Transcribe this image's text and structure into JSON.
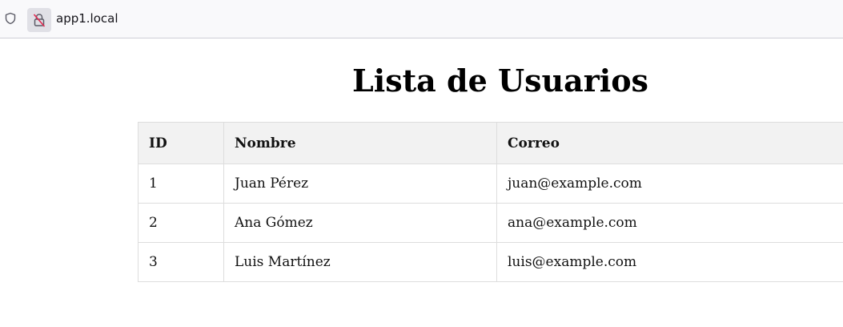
{
  "browser": {
    "host": "app1.local",
    "icons": [
      "shield-icon",
      "lock-insecure-icon"
    ]
  },
  "page": {
    "title": "Lista de Usuarios"
  },
  "table": {
    "headers": [
      "ID",
      "Nombre",
      "Correo"
    ],
    "rows": [
      [
        "1",
        "Juan Pérez",
        "juan@example.com"
      ],
      [
        "2",
        "Ana Gómez",
        "ana@example.com"
      ],
      [
        "3",
        "Luis Martínez",
        "luis@example.com"
      ]
    ]
  },
  "colors": {
    "header_bg": "#f2f2f2",
    "border": "#dddddd",
    "insecure_lock": "#e22850"
  }
}
